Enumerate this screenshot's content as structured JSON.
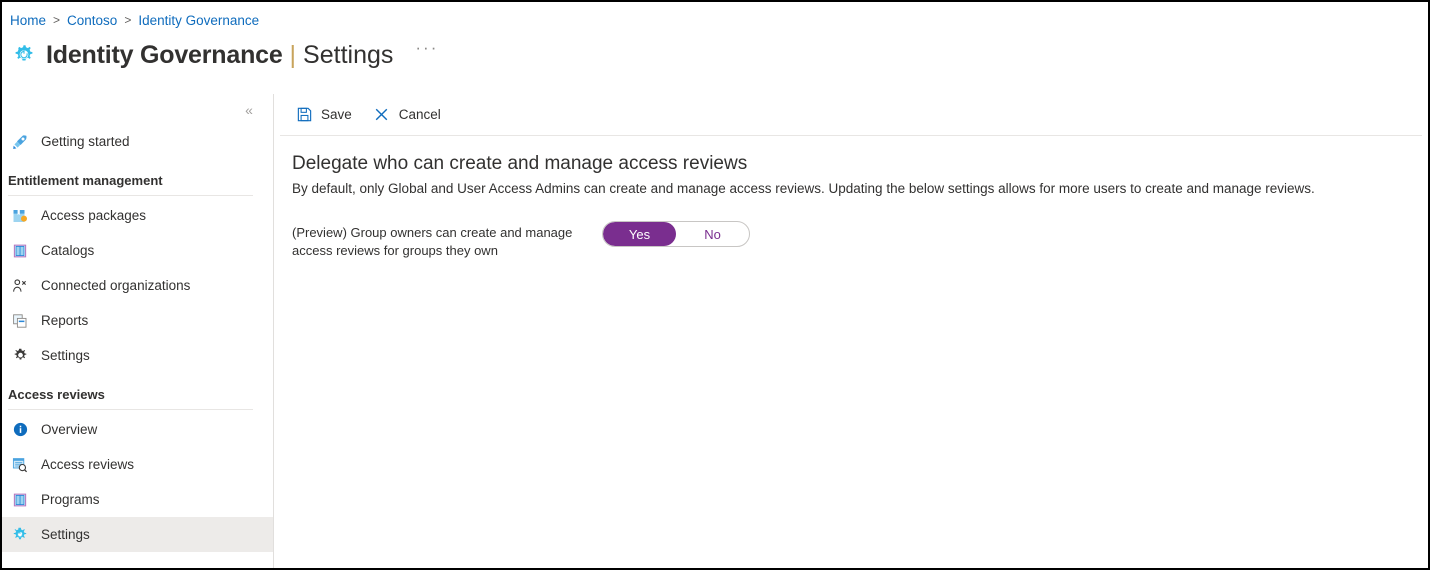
{
  "breadcrumb": [
    {
      "label": "Home"
    },
    {
      "label": "Contoso"
    },
    {
      "label": "Identity Governance"
    }
  ],
  "breadcrumb_separator": ">",
  "header": {
    "icon": "gear-icon",
    "title": "Identity Governance",
    "separator": "|",
    "subtitle": "Settings",
    "more_label": "···"
  },
  "sidebar": {
    "collapse_label": "«",
    "top_items": [
      {
        "label": "Getting started",
        "icon": "rocket-icon",
        "selected": false
      }
    ],
    "sections": [
      {
        "title": "Entitlement management",
        "items": [
          {
            "label": "Access packages",
            "icon": "package-icon",
            "selected": false
          },
          {
            "label": "Catalogs",
            "icon": "book-icon",
            "selected": false
          },
          {
            "label": "Connected organizations",
            "icon": "people-icon",
            "selected": false
          },
          {
            "label": "Reports",
            "icon": "report-icon",
            "selected": false
          },
          {
            "label": "Settings",
            "icon": "gear-dark-icon",
            "selected": false
          }
        ]
      },
      {
        "title": "Access reviews",
        "items": [
          {
            "label": "Overview",
            "icon": "info-icon",
            "selected": false
          },
          {
            "label": "Access reviews",
            "icon": "review-search-icon",
            "selected": false
          },
          {
            "label": "Programs",
            "icon": "book-icon",
            "selected": false
          },
          {
            "label": "Settings",
            "icon": "gear-blue-icon",
            "selected": true
          }
        ]
      }
    ]
  },
  "toolbar": {
    "save_label": "Save",
    "cancel_label": "Cancel"
  },
  "main": {
    "heading": "Delegate who can create and manage access reviews",
    "description": "By default, only Global and User Access Admins can create and manage access reviews. Updating the below settings allows for more users to create and manage reviews.",
    "setting": {
      "label": "(Preview) Group owners can create and manage access reviews for groups they own",
      "toggle": {
        "yes_label": "Yes",
        "no_label": "No",
        "value": "Yes"
      }
    }
  },
  "colors": {
    "accent_blue": "#0078d4",
    "link_blue": "#0f6cbd",
    "toggle_purple": "#7a2e8f",
    "cyan_icon": "#32bde8",
    "text": "#323130",
    "selected_row": "#edebe9",
    "pipe_gold": "#c8a45c"
  }
}
